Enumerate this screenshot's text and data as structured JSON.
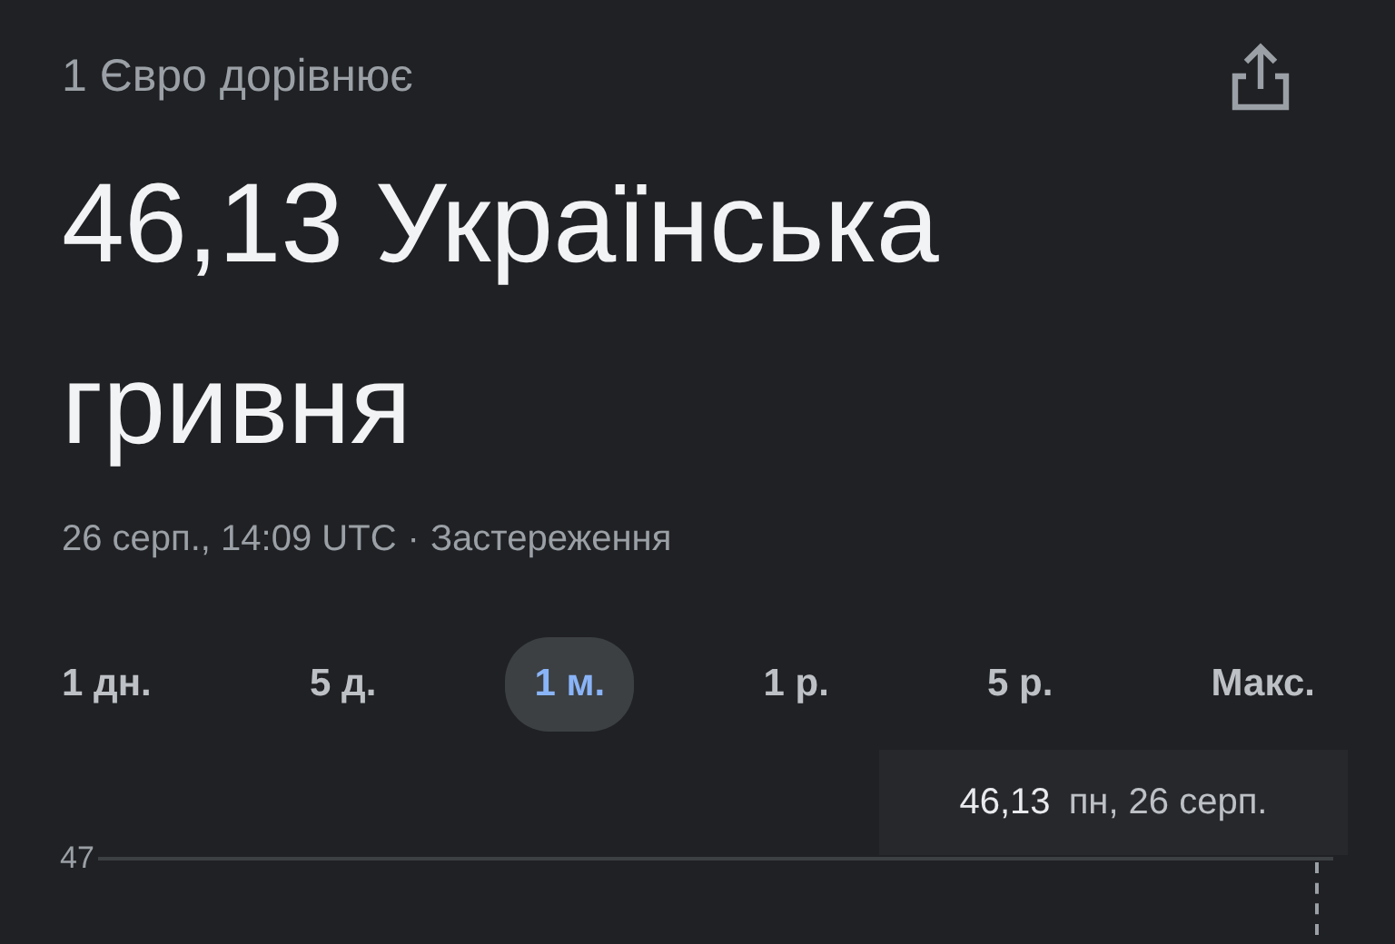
{
  "header": {
    "subtitle": "1 Євро дорівнює",
    "result": "46,13 Українська гривня"
  },
  "timestamp": {
    "time": "26 серп., 14:09 UTC",
    "separator": "·",
    "disclaimer": "Застереження"
  },
  "ranges": [
    {
      "label": "1 дн.",
      "selected": false
    },
    {
      "label": "5 д.",
      "selected": false
    },
    {
      "label": "1 м.",
      "selected": true
    },
    {
      "label": "1 р.",
      "selected": false
    },
    {
      "label": "5 р.",
      "selected": false
    },
    {
      "label": "Макс.",
      "selected": false
    }
  ],
  "chart": {
    "tooltip": {
      "value": "46,13",
      "date": "пн, 26 серп."
    },
    "y_label": "47"
  }
}
